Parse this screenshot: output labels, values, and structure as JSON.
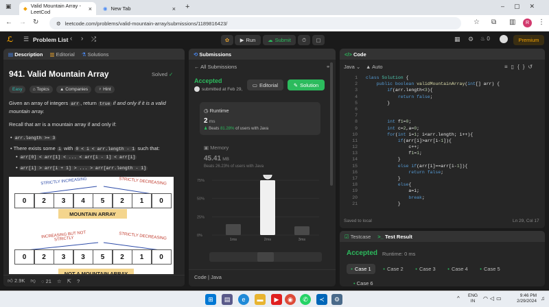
{
  "browser": {
    "tabs": [
      {
        "title": "Valid Mountain Array - LeetCod"
      },
      {
        "title": "New Tab"
      }
    ],
    "url": "leetcode.com/problems/valid-mountain-array/submissions/1189816423/",
    "profile_initial": "R"
  },
  "lc_nav": {
    "problem_list": "Problem List",
    "run": "Run",
    "submit": "Submit",
    "streak": "0",
    "premium": "Premium"
  },
  "description": {
    "tabs": [
      "Description",
      "Editorial",
      "Solutions"
    ],
    "title": "941. Valid Mountain Array",
    "status": "Solved",
    "badges": [
      "Easy",
      "Topics",
      "Companies",
      "Hint"
    ],
    "intro_pre": "Given an array of integers",
    "intro_code": "arr",
    "intro_mid": ", return",
    "intro_code2": "true",
    "intro_post": "if and only if it is a valid mountain array.",
    "recall": "Recall that arr is a mountain array if and only if:",
    "b1": "arr.length >= 3",
    "b2_pre": "There exists some",
    "b2_code1": "i",
    "b2_mid": "with",
    "b2_code2": "0 < i < arr.length - 1",
    "b2_post": "such that:",
    "s1": "arr[0] < arr[1] < ... < arr[i - 1] < arr[i]",
    "s2": "arr[i] > arr[i + 1] > ... > arr[arr.length - 1]",
    "fig1": {
      "values": [
        "0",
        "2",
        "3",
        "4",
        "5",
        "2",
        "1",
        "0"
      ],
      "left": "STRICTLY INCREASING",
      "right": "STRICTLY DECREASING",
      "caption": "MOUNTAIN ARRAY"
    },
    "fig2": {
      "values": [
        "0",
        "2",
        "3",
        "3",
        "5",
        "2",
        "1",
        "0"
      ],
      "left": "INCREASING BUT NOT STRICTLY",
      "right": "STRICTLY DECREASING",
      "caption": "NOT A MOUNTAIN ARRAY"
    },
    "likes": "2.9K",
    "comments": "21"
  },
  "submissions": {
    "header": "Submissions",
    "back": "All Submissions",
    "status": "Accepted",
    "submitted": "submitted at Feb 29,",
    "editorial_btn": "Editorial",
    "solution_btn": "Solution",
    "runtime_label": "Runtime",
    "runtime_value": "2",
    "runtime_unit": "ms",
    "beats_label": "Beats",
    "beats_pct": "81.28%",
    "beats_suffix": "of users with Java",
    "memory_label": "Memory",
    "memory_value": "45.41",
    "memory_unit": "MB",
    "memory_beats": "Beats 26.23% of users with Java",
    "code_label": "Code",
    "code_lang": "Java",
    "chart_data": {
      "type": "bar",
      "categories": [
        "1ms",
        "2ms",
        "3ms"
      ],
      "values": [
        15,
        85,
        12
      ],
      "ylim": [
        0,
        75
      ],
      "y_ticks": [
        "75%",
        "50%",
        "25%",
        "0%"
      ],
      "highlight": "2ms"
    }
  },
  "code": {
    "header": "Code",
    "lang": "Java",
    "auto": "Auto",
    "saved": "Saved to local",
    "position": "Ln 29, Col 17",
    "lines": [
      {
        "n": "1",
        "t": "class Solution {"
      },
      {
        "n": "2",
        "t": "    public boolean validMountainArray(int[] arr) {"
      },
      {
        "n": "3",
        "t": "        if(arr.length<3){"
      },
      {
        "n": "4",
        "t": "            return false;"
      },
      {
        "n": "5",
        "t": "        }"
      },
      {
        "n": "6",
        "t": ""
      },
      {
        "n": "7",
        "t": ""
      },
      {
        "n": "8",
        "t": "        int f1=0;"
      },
      {
        "n": "9",
        "t": "        int c=2,a=0;"
      },
      {
        "n": "10",
        "t": "        for(int i=1; i<arr.length; i++){"
      },
      {
        "n": "11",
        "t": "            if(arr[i]>arr[i-1]){"
      },
      {
        "n": "12",
        "t": "                c++;"
      },
      {
        "n": "13",
        "t": "                f1=1;"
      },
      {
        "n": "14",
        "t": "            }"
      },
      {
        "n": "15",
        "t": "            else if(arr[i]==arr[i-1]){"
      },
      {
        "n": "16",
        "t": "                return false;"
      },
      {
        "n": "17",
        "t": "            }"
      },
      {
        "n": "18",
        "t": "            else{"
      },
      {
        "n": "19",
        "t": "                a=i;"
      },
      {
        "n": "20",
        "t": "                break;"
      },
      {
        "n": "21",
        "t": "            }"
      }
    ]
  },
  "testcase": {
    "tab1": "Testcase",
    "tab2": "Test Result",
    "status": "Accepted",
    "runtime": "Runtime: 0 ms",
    "cases": [
      "Case 1",
      "Case 2",
      "Case 3",
      "Case 4",
      "Case 5",
      "Case 6"
    ]
  },
  "taskbar": {
    "lang": "ENG",
    "region": "IN",
    "time": "9:46 PM",
    "date": "2/29/2024"
  }
}
